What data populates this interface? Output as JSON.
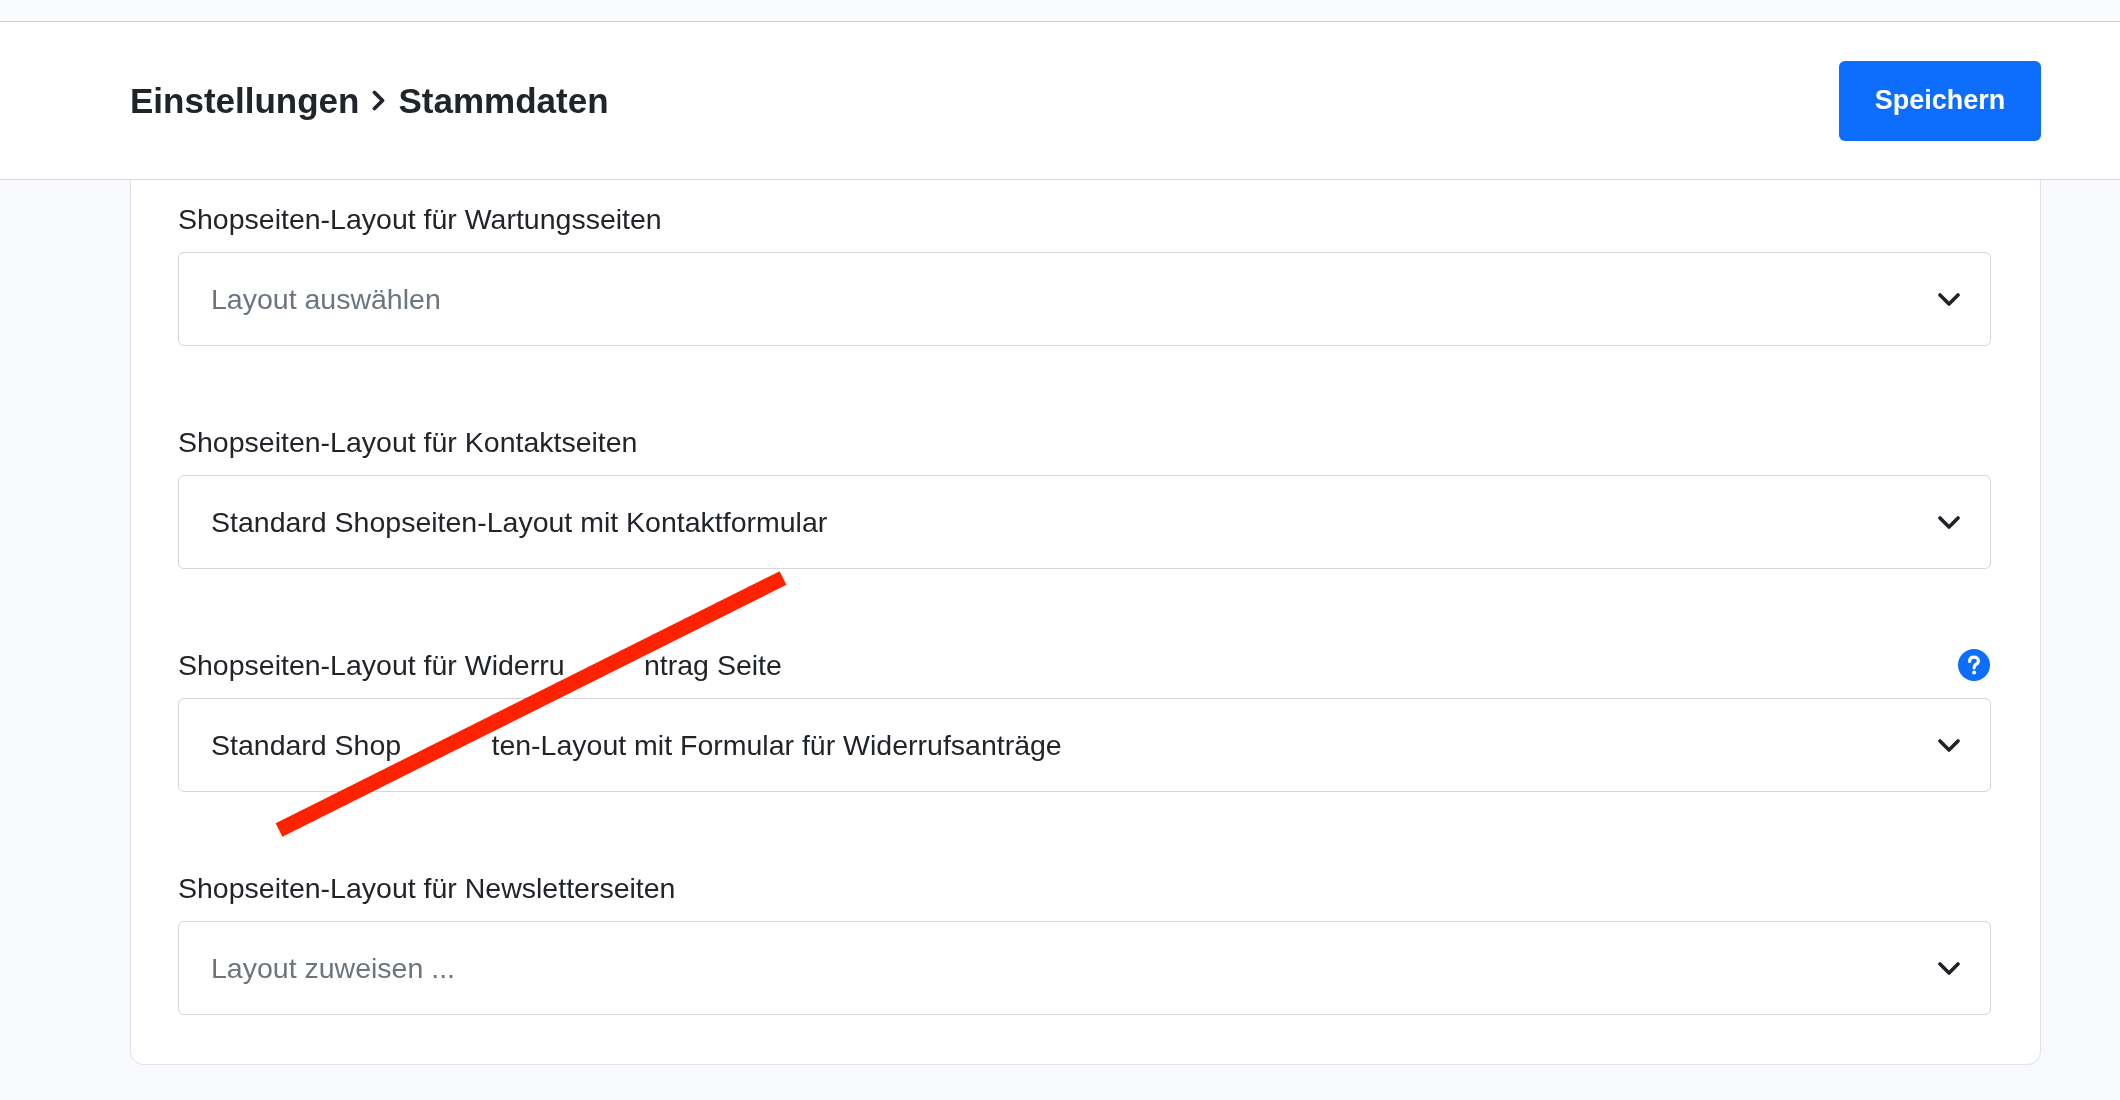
{
  "header": {
    "breadcrumb": [
      {
        "label": "Einstellungen"
      },
      {
        "label": "Stammdaten"
      }
    ],
    "save_button": "Speichern"
  },
  "fields": [
    {
      "label": [
        "Shopseiten-Layout für Wartungsseiten"
      ],
      "help": false,
      "placeholder": "Layout auswählen"
    },
    {
      "label": [
        "Shopseiten-Layout für Kontaktseiten"
      ],
      "help": false,
      "value": [
        "Standard Shopseiten-Layout mit Kontaktformular"
      ]
    },
    {
      "label": [
        "Shopseiten-Layout für Widerru",
        "ntrag Seite"
      ],
      "help": true,
      "value": [
        "Standard Shop",
        "ten-Layout mit Formular für Widerrufsanträge"
      ]
    },
    {
      "label": [
        "Shopseiten-Layout für Newsletterseiten"
      ],
      "help": false,
      "placeholder": "Layout zuweisen ..."
    }
  ]
}
